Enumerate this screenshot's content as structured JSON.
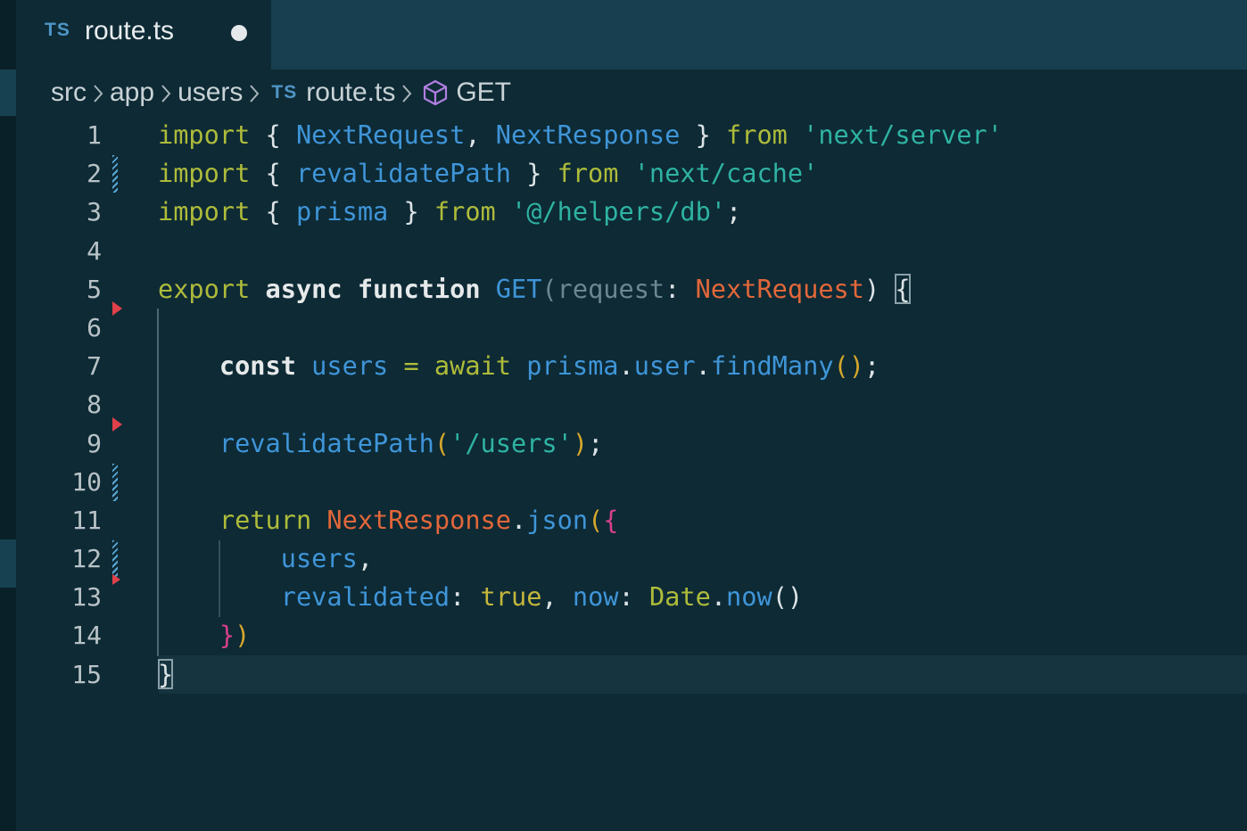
{
  "tab": {
    "icon": "TS",
    "title": "route.ts"
  },
  "breadcrumb": {
    "items": [
      "src",
      "app",
      "users"
    ],
    "file_icon": "TS",
    "file": "route.ts",
    "symbol": "GET"
  },
  "line_numbers": [
    "1",
    "2",
    "3",
    "4",
    "5",
    "6",
    "7",
    "8",
    "9",
    "10",
    "11",
    "12",
    "13",
    "14",
    "15"
  ],
  "code": {
    "l1": {
      "import": "import",
      "ob": "{",
      "a": "NextRequest",
      "comma": ",",
      "b": "NextResponse",
      "cb": "}",
      "from": "from",
      "src": "'next/server'"
    },
    "l2": {
      "import": "import",
      "ob": "{",
      "a": "revalidatePath",
      "cb": "}",
      "from": "from",
      "src": "'next/cache'"
    },
    "l3": {
      "import": "import",
      "ob": "{",
      "a": "prisma",
      "cb": "}",
      "from": "from",
      "src": "'@/helpers/db'",
      "semi": ";"
    },
    "l5": {
      "export": "export",
      "async": "async",
      "function": "function",
      "name": "GET",
      "op": "(",
      "param": "request",
      "colon": ":",
      "type": "NextRequest",
      "cp": ")",
      "brace": "{"
    },
    "l7": {
      "const": "const",
      "var": "users",
      "eq": "=",
      "await": "await",
      "obj": "prisma",
      "dot1": ".",
      "prop": "user",
      "dot2": ".",
      "fn": "findMany",
      "parens": "()",
      "semi": ";"
    },
    "l9": {
      "fn": "revalidatePath",
      "op": "(",
      "str": "'/users'",
      "cp": ")",
      "semi": ";"
    },
    "l11": {
      "return": "return",
      "cls": "NextResponse",
      "dot": ".",
      "fn": "json",
      "op": "(",
      "ob": "{"
    },
    "l12": {
      "prop": "users",
      "comma": ","
    },
    "l13": {
      "k1": "revalidated",
      "c1": ":",
      "v1": "true",
      "comma": ",",
      "k2": "now",
      "c2": ":",
      "cls": "Date",
      "dot": ".",
      "fn": "now",
      "parens": "()"
    },
    "l14": {
      "cb": "}",
      "cp": ")"
    },
    "l15": {
      "cb": "}"
    }
  },
  "colors": {
    "background": "#0d2a35",
    "tabbar": "#173f4f",
    "keyword": "#aebb3a",
    "type": "#3f95d8",
    "string": "#2fb3a2",
    "type_param": "#e2673a",
    "bracket_pink": "#d6408c",
    "bracket_gold": "#d6a72c"
  }
}
